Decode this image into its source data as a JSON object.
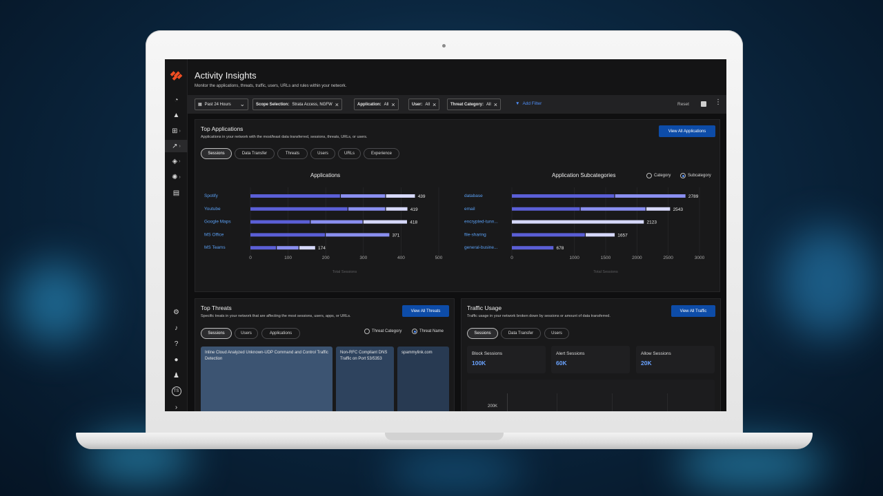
{
  "app": {
    "title": "Activity Insights",
    "subtitle": "Monitor the applications, threats, traffic, users, URLs and rules within your network."
  },
  "rail": {
    "icons": [
      "dashboard-icon",
      "alert-icon",
      "network-icon",
      "activity-icon",
      "shield-icon",
      "gear-cycle-icon",
      "report-icon",
      "settings-icon",
      "bell-icon",
      "help-icon",
      "chat-icon",
      "user-icon",
      "avatar",
      "expand-icon"
    ],
    "avatar_initials": "TS"
  },
  "filters": {
    "time": "Past 24 Hours",
    "scope_label": "Scope Selection:",
    "scope_value": "Strata Access, NGFW",
    "application_label": "Application:",
    "application_value": "All",
    "user_label": "User:",
    "user_value": "All",
    "threat_label": "Threat Category:",
    "threat_value": "All",
    "add_filter": "Add Filter",
    "reset": "Reset"
  },
  "top_applications": {
    "title": "Top Applications",
    "subtitle": "Applications in your network with the most/least data transferred, sessions, threats, URLs, or users.",
    "button": "View All Applications",
    "tabs": [
      "Sessions",
      "Data Transfer",
      "Threats",
      "Users",
      "URLs",
      "Experience"
    ],
    "selected_tab": "Sessions",
    "radio_category": "Category",
    "radio_subcategory": "Subcategory",
    "colors": {
      "seg_dark": "#5b5fd6",
      "seg_mid": "#8a8ff0",
      "seg_light": "#d6d8fb"
    }
  },
  "chart_data": [
    {
      "type": "bar",
      "orientation": "horizontal",
      "title": "Applications",
      "categories": [
        "Spotify",
        "Youtube",
        "Google Maps",
        "MS Office",
        "MS Teams"
      ],
      "values": [
        439,
        419,
        418,
        371,
        174
      ],
      "segments": [
        [
          240,
          120,
          79
        ],
        [
          260,
          100,
          59
        ],
        [
          160,
          140,
          118
        ],
        [
          200,
          171,
          0
        ],
        [
          70,
          60,
          44
        ]
      ],
      "xlabel": "Total Sessions",
      "xlim": [
        0,
        500
      ],
      "xticks": [
        0,
        100,
        200,
        300,
        400,
        500
      ]
    },
    {
      "type": "bar",
      "orientation": "horizontal",
      "title": "Application Subcategories",
      "categories": [
        "database",
        "email",
        "encrypted-tunn...",
        "file-sharing",
        "general-busine..."
      ],
      "values": [
        2789,
        2543,
        2123,
        1657,
        678
      ],
      "segments": [
        [
          1650,
          1139,
          0
        ],
        [
          1100,
          1050,
          393
        ],
        [
          0,
          0,
          2123
        ],
        [
          1180,
          0,
          477
        ],
        [
          678,
          0,
          0
        ]
      ],
      "xlabel": "Total Sessions",
      "xlim": [
        0,
        3000
      ],
      "xticks": [
        0,
        1000,
        1500,
        2000,
        2500,
        3000
      ]
    }
  ],
  "top_threats": {
    "title": "Top Threats",
    "subtitle": "Specific treats in your network that are affecting the most sessions, users, apps, or URLs.",
    "button": "View All Threats",
    "tabs": [
      "Sessions",
      "Users",
      "Applications"
    ],
    "selected_tab": "Sessions",
    "radio_category": "Threat Category",
    "radio_name": "Threat Name",
    "cards": [
      "Inline Cloud Analyzed Unknown-UDP Command and Control Traffic Detection",
      "Non-RFC Compliant DNS Traffic on Port 53/5353",
      "spammylink.com"
    ]
  },
  "traffic_usage": {
    "title": "Traffic Usage",
    "subtitle": "Traffic usage in your network broken down by sessions or amount of data transferred.",
    "button": "View All Traffic",
    "tabs": [
      "Sessions",
      "Data Transfer",
      "Users"
    ],
    "selected_tab": "Sessions",
    "stats": [
      {
        "label": "Block Sessions",
        "value": "100K"
      },
      {
        "label": "Alert Sessions",
        "value": "60K"
      },
      {
        "label": "Allow Sessions",
        "value": "20K"
      }
    ],
    "chart_tick": "200K"
  }
}
